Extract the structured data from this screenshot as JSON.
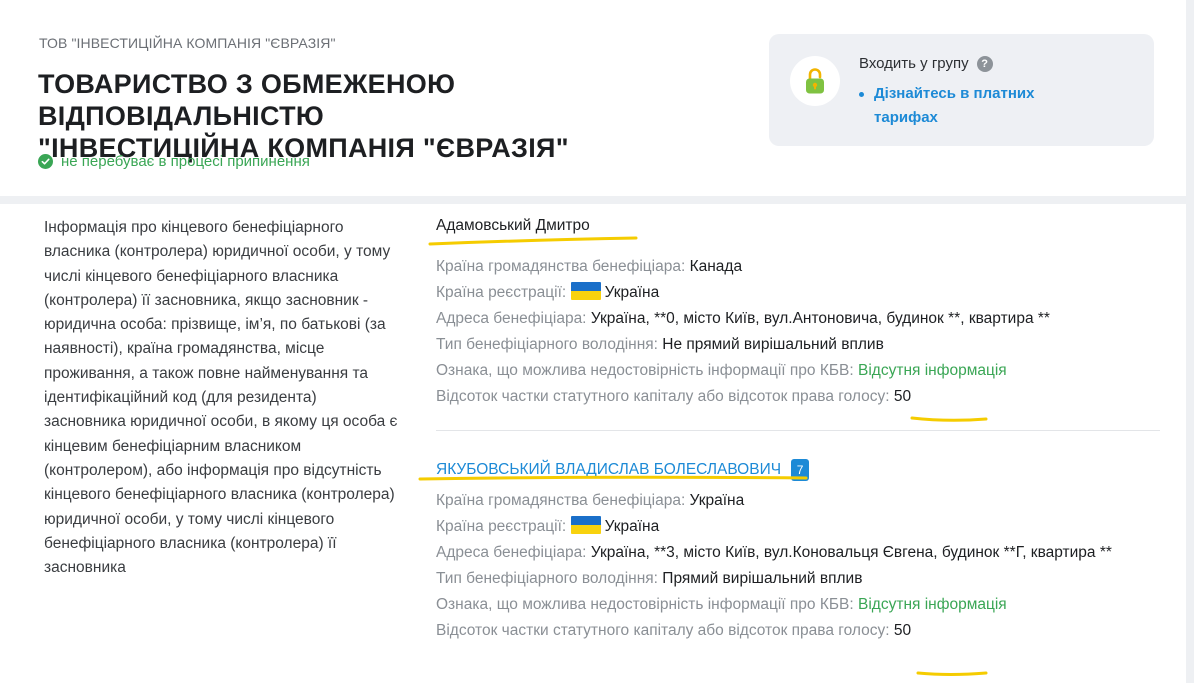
{
  "header": {
    "short_name": "ТОВ \"ІНВЕСТИЦІЙНА КОМПАНІЯ \"ЄВРАЗІЯ\"",
    "full_name_line1": "ТОВАРИСТВО З ОБМЕЖЕНОЮ ВІДПОВІДАЛЬНІСТЮ",
    "full_name_line2": "\"ІНВЕСТИЦІЙНА КОМПАНІЯ \"ЄВРАЗІЯ\"",
    "status_text": "не перебуває в процесі припинення",
    "status_icon": "check-circle-icon"
  },
  "group_card": {
    "icon": "lock-icon",
    "title": "Входить у групу",
    "help_icon": "question-icon",
    "link_line1": "Дізнайтесь в платних",
    "link_line2": "тарифах"
  },
  "section": {
    "description": "Інформація про кінцевого бенефіціарного власника (контролера) юридичної особи, у тому числі кінцевого бенефіціарного власника (контролера) її засновника, якщо засновник - юридична особа: прізвище, ім’я, по батькові (за наявності), країна громадянства, місце проживання, а також повне найменування та ідентифікаційний код (для резидента) засновника юридичної особи, в якому ця особа є кінцевим бенефіціарним власником (контролером), або інформація про відсутність кінцевого бенефіціарного власника (контролера) юридичної особи, у тому числі кінцевого бенефіціарного власника (контролера) її засновника"
  },
  "labels": {
    "citizenship": "Країна громадянства бенефіціара:",
    "registration": "Країна реєстрації:",
    "address": "Адреса бенефіціара:",
    "ownership_type": "Тип бенефіціарного володіння:",
    "unreliable": "Ознака, що можлива недостовірність інформації про КБВ:",
    "share": "Відсоток частки статутного капіталу або відсоток права голосу:"
  },
  "beneficiaries": [
    {
      "name": "Адамовський Дмитро",
      "citizenship": "Канада",
      "registration": "Україна",
      "address": "Україна, **0, місто Київ, вул.Антоновича, будинок **, квартира **",
      "ownership_type": "Не прямий вирішальний вплив",
      "unreliable": "Відсутня інформація",
      "share": "50"
    },
    {
      "name": "ЯКУБОВСЬКИЙ ВЛАДИСЛАВ БОЛЕСЛАВОВИЧ",
      "badge": "7",
      "citizenship": "Україна",
      "registration": "Україна",
      "address": "Україна, **3, місто Київ, вул.Коновальця Євгена, будинок **Г, квартира **",
      "ownership_type": "Прямий вирішальний вплив",
      "unreliable": "Відсутня інформація",
      "share": "50"
    }
  ],
  "colors": {
    "accent_blue": "#1d8ad6",
    "status_green": "#3aa655",
    "highlight_yellow": "#f5cc00",
    "flag_blue": "#1a6fc9",
    "flag_yellow": "#f8d20e"
  }
}
